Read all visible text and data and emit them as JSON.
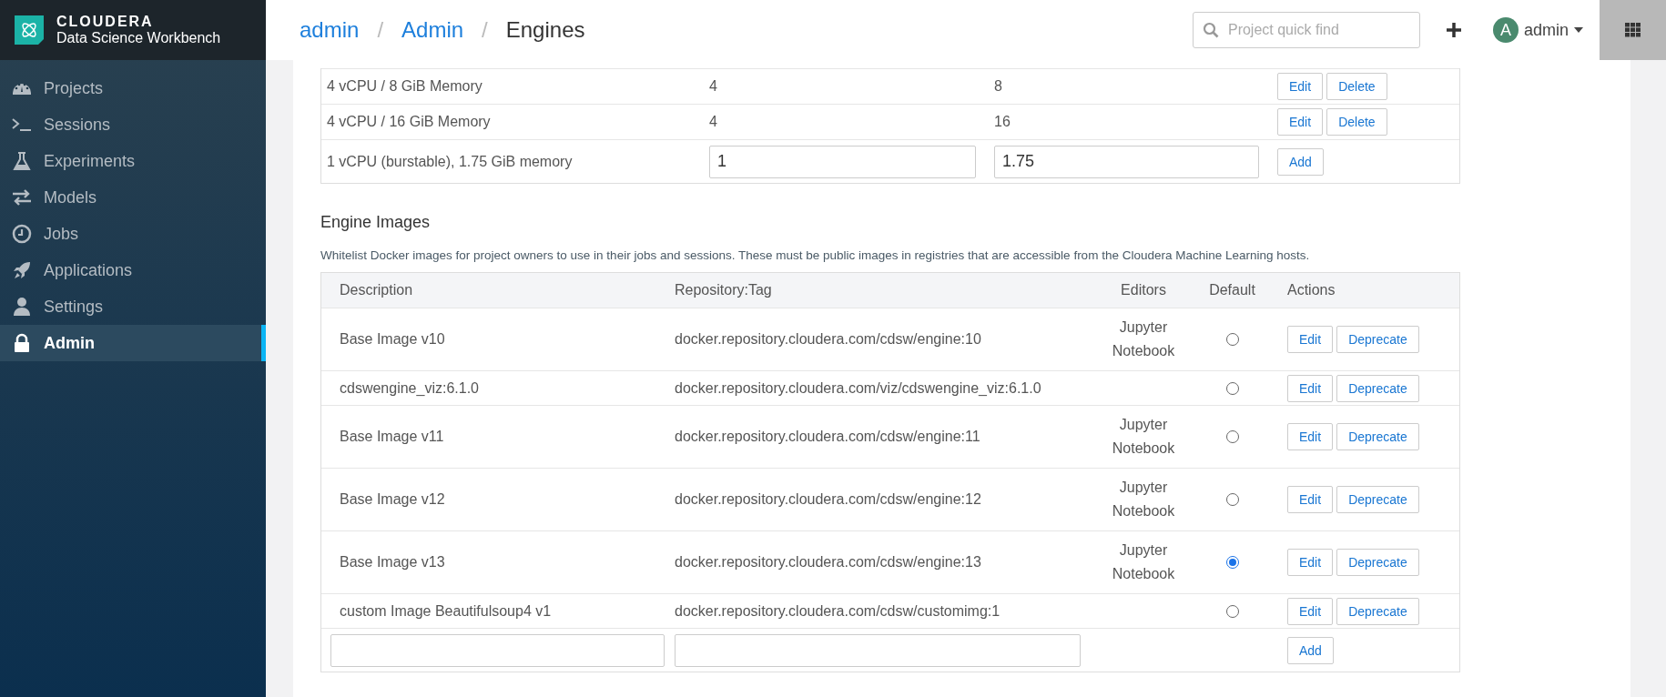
{
  "sidebar": {
    "brand": "CLOUDERA",
    "product": "Data Science Workbench",
    "items": [
      {
        "label": "Projects",
        "selected": false
      },
      {
        "label": "Sessions",
        "selected": false
      },
      {
        "label": "Experiments",
        "selected": false
      },
      {
        "label": "Models",
        "selected": false
      },
      {
        "label": "Jobs",
        "selected": false
      },
      {
        "label": "Applications",
        "selected": false
      },
      {
        "label": "Settings",
        "selected": false
      },
      {
        "label": "Admin",
        "selected": true
      }
    ]
  },
  "header": {
    "breadcrumbs": [
      {
        "label": "admin",
        "link": true
      },
      {
        "label": "Admin",
        "link": true
      },
      {
        "label": "Engines",
        "link": false
      }
    ],
    "separator": "/",
    "search": {
      "placeholder": "Project quick find"
    },
    "user": {
      "initial": "A",
      "name": "admin"
    }
  },
  "engine_profiles": {
    "rows": [
      {
        "description": "4 vCPU / 8 GiB Memory",
        "cpu": "4",
        "memory": "8",
        "actions": [
          "Edit",
          "Delete"
        ]
      },
      {
        "description": "4 vCPU / 16 GiB Memory",
        "cpu": "4",
        "memory": "16",
        "actions": [
          "Edit",
          "Delete"
        ]
      }
    ],
    "new_row": {
      "description": "1 vCPU (burstable), 1.75 GiB memory",
      "cpu": "1",
      "memory": "1.75",
      "action": "Add"
    }
  },
  "engine_images": {
    "title": "Engine Images",
    "description": "Whitelist Docker images for project owners to use in their jobs and sessions. These must be public images in registries that are accessible from the Cloudera Machine Learning hosts.",
    "columns": [
      "Description",
      "Repository:Tag",
      "Editors",
      "Default",
      "Actions"
    ],
    "rows": [
      {
        "description": "Base Image v10",
        "repository": "docker.repository.cloudera.com/cdsw/engine:10",
        "editors": "Jupyter Notebook",
        "default": false,
        "actions": [
          "Edit",
          "Deprecate"
        ]
      },
      {
        "description": "cdswengine_viz:6.1.0",
        "repository": "docker.repository.cloudera.com/viz/cdswengine_viz:6.1.0",
        "default": false,
        "actions": [
          "Edit",
          "Deprecate"
        ]
      },
      {
        "description": "Base Image v11",
        "repository": "docker.repository.cloudera.com/cdsw/engine:11",
        "editors": "Jupyter Notebook",
        "default": false,
        "actions": [
          "Edit",
          "Deprecate"
        ]
      },
      {
        "description": "Base Image v12",
        "repository": "docker.repository.cloudera.com/cdsw/engine:12",
        "editors": "Jupyter Notebook",
        "default": false,
        "actions": [
          "Edit",
          "Deprecate"
        ]
      },
      {
        "description": "Base Image v13",
        "repository": "docker.repository.cloudera.com/cdsw/engine:13",
        "editors": "Jupyter Notebook",
        "default": true,
        "actions": [
          "Edit",
          "Deprecate"
        ]
      },
      {
        "description": "custom Image Beautifulsoup4 v1",
        "repository": "docker.repository.cloudera.com/cdsw/customimg:1",
        "default": false,
        "actions": [
          "Edit",
          "Deprecate"
        ]
      }
    ],
    "add_button": "Add"
  }
}
